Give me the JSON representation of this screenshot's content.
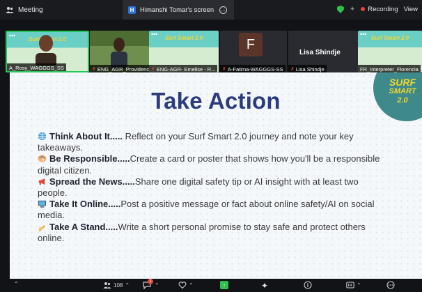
{
  "top_bar": {
    "app_label": "Meeting",
    "screen_tab_badge": "H",
    "screen_tab_title": "Himanshi Tomar's screen",
    "more_label": "…",
    "recording_label": "Recording",
    "view_label": "View"
  },
  "participants": [
    {
      "name": "A_Rosy_WAGGGS_SS",
      "muted": false,
      "active_speaker": true,
      "banner": "Surf Smart 2.0"
    },
    {
      "name": "ENG_AGR_Providence",
      "muted": true,
      "active_speaker": false
    },
    {
      "name": "ENG-AGR- Emelise - R...",
      "muted": true,
      "active_speaker": false,
      "banner": "Surf Smart 2.0"
    },
    {
      "name": "A-Fatima-WAGGGS-SS",
      "muted": true,
      "active_speaker": false,
      "avatar_letter": "F"
    },
    {
      "name": "Lisa Shindje",
      "muted": true,
      "active_speaker": false,
      "display_name": "Lisa Shindje"
    },
    {
      "name": "FR_Interpreter_Florencia",
      "muted": false,
      "active_speaker": false,
      "banner": "Surf Smart 2.0"
    }
  ],
  "slide": {
    "title": "Take Action",
    "logo_lines": [
      "SURF",
      "SMART",
      "2.0"
    ],
    "items": [
      {
        "icon": "globe-icon",
        "heading": "Think About It.....",
        "text": " Reflect on your Surf Smart 2.0 journey and note your key takeaways."
      },
      {
        "icon": "palette-icon",
        "heading": "Be Responsible.....",
        "text": "Create a card or poster that shows how you'll be a responsible digital citizen."
      },
      {
        "icon": "megaphone-icon",
        "heading": "Spread the News.....",
        "text": "Share one digital safety tip or AI insight with at least two people."
      },
      {
        "icon": "computer-icon",
        "heading": "Take It Online.....",
        "text": "Post a positive message or fact about online safety/AI on social media."
      },
      {
        "icon": "writing-hand-icon",
        "heading": "Take A Stand.....",
        "text": "Write a short personal promise to stay safe and protect others online."
      }
    ]
  },
  "toolbar": {
    "participants_count": "108",
    "chat_badge": "1",
    "colors": {
      "accent_green": "#2fbf4c",
      "recording_red": "#e5453b",
      "title_navy": "#2c3c7d",
      "logo_teal": "#3e8a8a"
    }
  }
}
